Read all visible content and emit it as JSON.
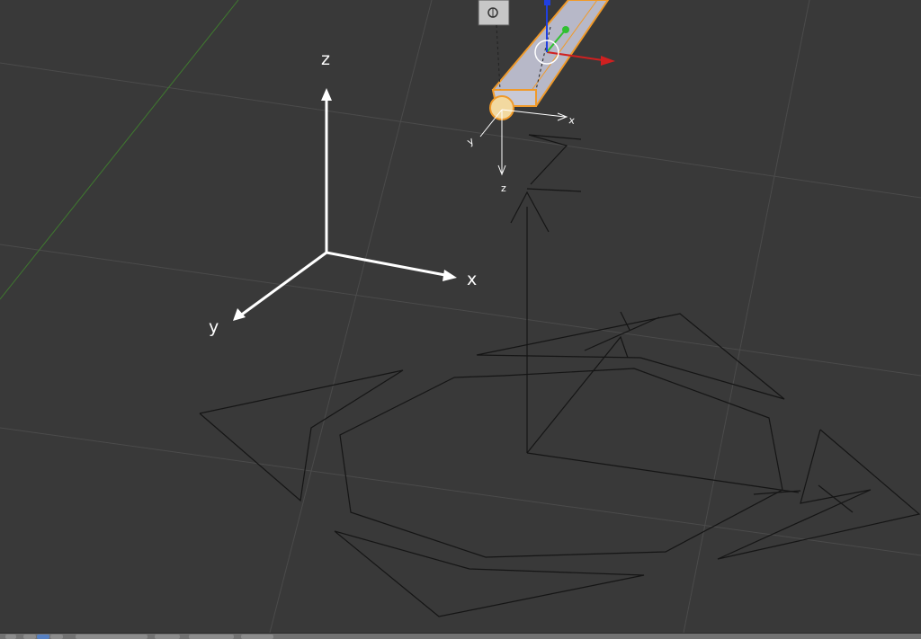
{
  "viewport": {
    "axis_labels": {
      "x": "x",
      "y": "y",
      "z": "z"
    },
    "bone_local_labels": {
      "x": "x",
      "y": "y",
      "z": "z"
    },
    "colors": {
      "background": "#393939",
      "grid": "#4a4a4a",
      "y_axis_line": "#3f7a2f",
      "wire": "#111111",
      "axes": "#ffffff",
      "bone_fill": "#b9b9c8",
      "bone_outline": "#f09a2a",
      "manip_x": "#d02020",
      "manip_y": "#30c030",
      "manip_z": "#2040e0"
    }
  },
  "header": {
    "buttons": [
      "view-menu",
      "select-mode-vertex",
      "select-mode-edge",
      "select-mode-face",
      "pivot",
      "shading",
      "snap",
      "layers"
    ]
  }
}
